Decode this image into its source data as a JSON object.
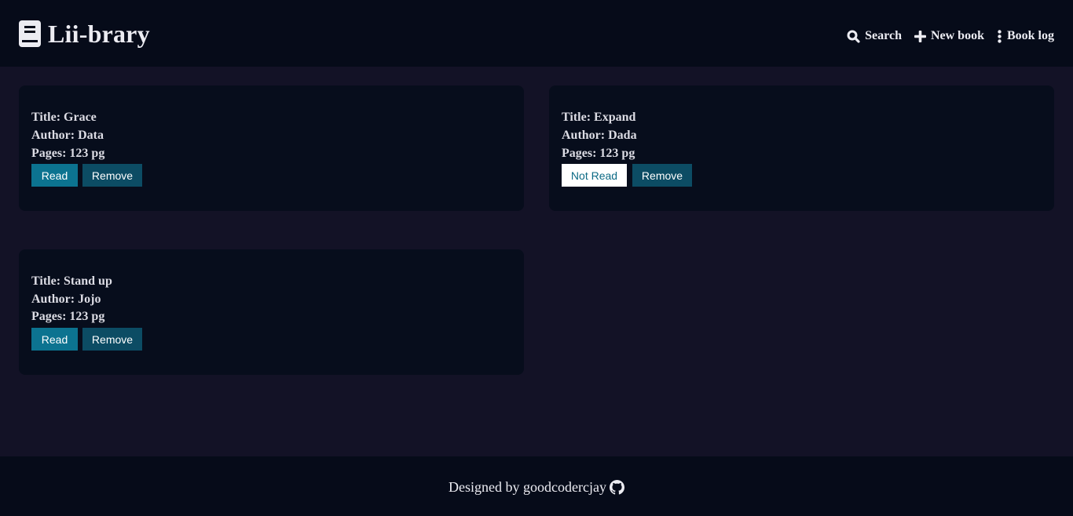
{
  "header": {
    "brand_icon": "book-icon",
    "title": "Lii-brary",
    "nav": [
      {
        "label": "Search",
        "icon": "search-icon"
      },
      {
        "label": "New book",
        "icon": "plus-icon"
      },
      {
        "label": "Book log",
        "icon": "vertical-dots-icon"
      }
    ]
  },
  "books": [
    {
      "title": "Title: Grace",
      "author": "Author: Data",
      "pages": "Pages: 123 pg",
      "status_label": "Read",
      "remove_label": "Remove"
    },
    {
      "title": "Title: Expand",
      "author": "Author: Dada",
      "pages": "Pages: 123 pg",
      "status_label": "Not Read",
      "remove_label": "Remove"
    },
    {
      "title": "Title: Stand up",
      "author": "Author: Jojo",
      "pages": "Pages: 123 pg",
      "status_label": "Read",
      "remove_label": "Remove"
    }
  ],
  "footer": {
    "text": "Designed by goodcodercjay",
    "icon": "github-icon"
  },
  "colors": {
    "page_bg": "#131226",
    "bar_bg": "#060b19",
    "card_bg": "#070d1c",
    "read_button": "#0c7390",
    "remove_button": "#0c4c64",
    "not_read_button": "#ffffff"
  }
}
